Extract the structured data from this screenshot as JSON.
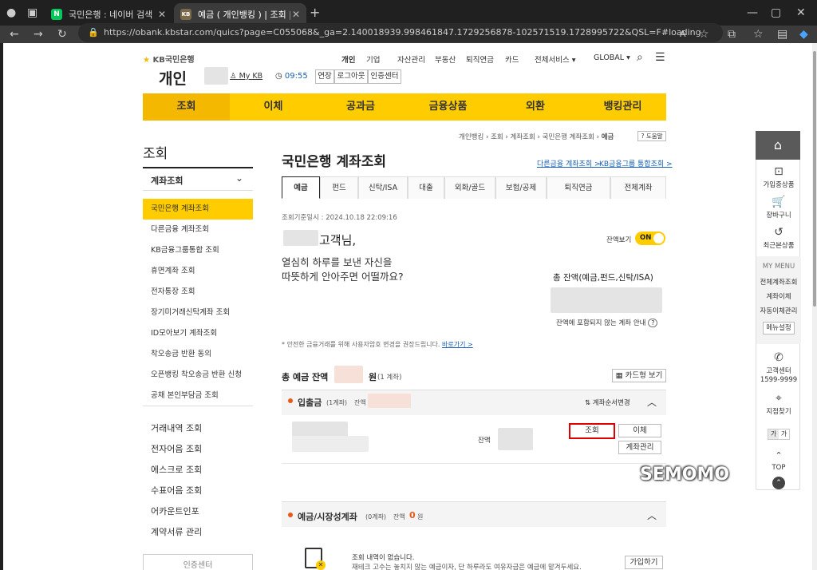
{
  "browser": {
    "tabs": [
      {
        "title": "국민은행 : 네이버 검색",
        "favicon": "N"
      },
      {
        "title": "예금 ( 개인뱅킹 ) | 조회 | 계좌조회",
        "favicon": "KB"
      }
    ],
    "url": "https://obank.kbstar.com/quics?page=C055068&_ga=2.140018939.998461847.1729256878-102571519.1728995722&QSL=F#loading",
    "accent": "#ffcc00"
  },
  "header": {
    "logo": "KB국민은행",
    "section": "개인",
    "mykb": "My KB",
    "timer": "09:55",
    "extend": "연장",
    "logout": "로그아웃",
    "cert": "인증센터",
    "top_links": [
      "개인",
      "기업",
      "자산관리",
      "부동산",
      "퇴직연금",
      "카드",
      "전체서비스",
      "GLOBAL"
    ]
  },
  "gnb": [
    "조회",
    "이체",
    "공과금",
    "금융상품",
    "외환",
    "뱅킹관리"
  ],
  "breadcrumb": [
    "개인뱅킹",
    "조회",
    "계좌조회",
    "국민은행 계좌조회",
    "예금"
  ],
  "help": "? 도움말",
  "sidebar": {
    "title": "조회",
    "group": "계좌조회",
    "sub": [
      "국민은행 계좌조회",
      "다른금융 계좌조회",
      "KB금융그룹통합 조회",
      "휴면계좌 조회",
      "전자통장 조회",
      "장기미거래신탁계좌 조회",
      "ID모아보기 계좌조회",
      "착오송금 반환 동의",
      "오픈뱅킹 착오송금 반환 신청",
      "공채 본인부담금 조회"
    ],
    "main": [
      "거래내역 조회",
      "전자어음 조회",
      "에스크로 조회",
      "수표어음 조회",
      "어카운트인포",
      "계약서류 관리"
    ]
  },
  "content": {
    "title": "국민은행 계좌조회",
    "link1": "다른금융 계좌조회 >",
    "link2": "KB금융그룹 통합조회 >",
    "tabs": [
      "예금",
      "펀드",
      "신탁/ISA",
      "대출",
      "외화/골드",
      "보험/공제",
      "퇴직연금",
      "전체계좌"
    ],
    "timestamp": "조회기준일시 : 2024.10.18 22:09:16",
    "greeting_suffix": "고객님,",
    "greeting_line1": "열심히 하루를 보낸 자신을",
    "greeting_line2": "따뜻하게 안아주면 어떨까요?",
    "balance_toggle_label": "잔액보기",
    "toggle_state": "ON",
    "total_label": "총 잔액(예금,펀드,신탁/ISA)",
    "excluded_label": "잔액에 포함되지 않는 계좌 안내",
    "notice": "* 안전한 금융거래를 위해 사용자암호 변경을 권장드립니다.",
    "notice_link": "바로가기 >",
    "deposit_total_prefix": "총 예금 잔액",
    "deposit_total_suffix": "원",
    "deposit_total_count": "(1 계좌)",
    "card_view": "카드형 보기",
    "section1_title": "입출금",
    "section1_count": "(1계좌)",
    "section1_balance_label": "잔액",
    "order_change": "계좌순서변경",
    "row_balance_label": "잔액",
    "btn_inquiry": "조회",
    "btn_transfer": "이체",
    "btn_manage": "계좌관리",
    "section2_title": "예금/시장성계좌",
    "section2_count": "(0계좌)",
    "section2_balance_label": "잔액",
    "section2_balance_value": "0",
    "section2_balance_unit": "원",
    "empty_line1": "조회 내역이 없습니다.",
    "empty_line2": "재테크 고수는 놓치지 않는 예금이자, 단 하루라도 여유자금은 예금에 맡겨두세요.",
    "join_btn": "가입하기",
    "side_btn": "인증센터"
  },
  "rail": {
    "items": [
      "가입중상품",
      "장바구니",
      "최근본상품"
    ],
    "mymenu": "MY MENU",
    "mymenu_items": [
      "전체계좌조회",
      "계좌이체",
      "자동이체관리"
    ],
    "menu_setting": "메뉴설정",
    "center": "고객센터",
    "phone": "1599-9999",
    "branch": "지점찾기",
    "font_small": "가",
    "font_large": "가",
    "top": "TOP"
  },
  "watermark": "SEMOMO"
}
